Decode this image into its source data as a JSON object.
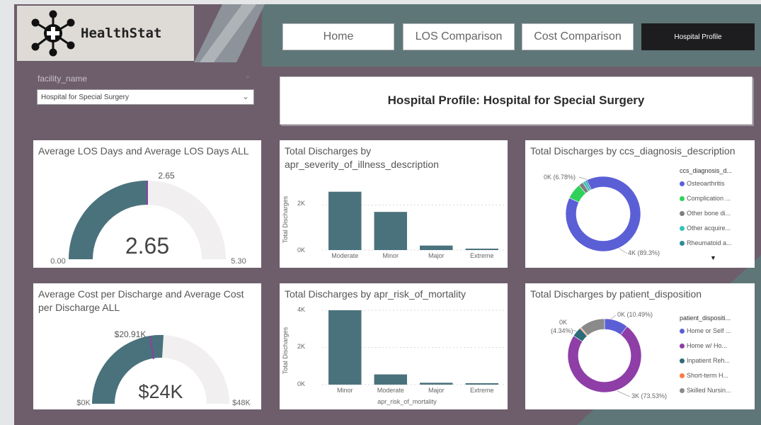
{
  "app": {
    "name": "HealthStat"
  },
  "nav": {
    "home": "Home",
    "los_comparison": "LOS Comparison",
    "cost_comparison": "Cost Comparison",
    "hospital_profile": "Hospital Profile"
  },
  "filter": {
    "label": "facility_name",
    "selected": "Hospital for Special Surgery"
  },
  "page_title": "Hospital Profile: Hospital for Special Surgery",
  "colors": {
    "teal": "#4a727c",
    "gauge_bg": "#f1efef",
    "purple_bg": "#6e5e6c",
    "blue": "#5b5fd6",
    "purple": "#8e3ea6",
    "green": "#2fd15a"
  },
  "cards": {
    "los_gauge": {
      "title": "Average LOS Days and Average LOS Days ALL",
      "value": "2.65",
      "target": "2.65",
      "min": "0.00",
      "max": "5.30"
    },
    "cost_gauge": {
      "title": "Average Cost per Discharge and Average Cost per Discharge ALL",
      "value": "$24K",
      "target": "$20.91K",
      "min": "$0K",
      "max": "$48K"
    },
    "severity": {
      "title": "Total Discharges by apr_severity_of_illness_description",
      "ylabel": "Total Discharges",
      "yticks": [
        "2K",
        "0K"
      ]
    },
    "mortality": {
      "title": "Total Discharges by apr_risk_of_mortality",
      "ylabel": "Total Discharges",
      "xlabel": "apr_risk_of_mortality",
      "yticks": [
        "4K",
        "2K",
        "0K"
      ]
    },
    "diagnosis": {
      "title": "Total Discharges by ccs_diagnosis_description",
      "legend_title": "ccs_diagnosis_d...",
      "legend": [
        "Osteoarthritis",
        "Complication ...",
        "Other bone di...",
        "Other acquire...",
        "Rheumatoid a..."
      ],
      "legend_colors": [
        "#5b5fd6",
        "#2fd15a",
        "#7f7f7f",
        "#33c4b6",
        "#2f8a99"
      ],
      "labels": [
        "0K (6.78%)",
        "4K (89.3%)"
      ]
    },
    "disposition": {
      "title": "Total Discharges by patient_disposition",
      "legend_title": "patient_dispositi...",
      "legend": [
        "Home or Self ...",
        "Home w/ Ho...",
        "Inpatient Reh...",
        "Short-term H...",
        "Skilled Nursin..."
      ],
      "legend_colors": [
        "#5b5fd6",
        "#8e3ea6",
        "#2e6b78",
        "#ff7a45",
        "#8a8a8a"
      ],
      "labels": [
        "0K (10.49%)",
        "0K",
        "(4.34%)",
        "3K (73.53%)"
      ]
    }
  },
  "chart_data": [
    {
      "type": "bar",
      "title": "Total Discharges by apr_severity_of_illness_description",
      "ylabel": "Total Discharges",
      "categories": [
        "Moderate",
        "Minor",
        "Major",
        "Extreme"
      ],
      "values": [
        2600,
        1700,
        200,
        30
      ],
      "ylim": [
        0,
        3000
      ]
    },
    {
      "type": "bar",
      "title": "Total Discharges by apr_risk_of_mortality",
      "xlabel": "apr_risk_of_mortality",
      "ylabel": "Total Discharges",
      "categories": [
        "Minor",
        "Moderate",
        "Major",
        "Extreme"
      ],
      "values": [
        4000,
        550,
        100,
        20
      ],
      "ylim": [
        0,
        4000
      ]
    },
    {
      "type": "pie",
      "title": "Total Discharges by ccs_diagnosis_description",
      "categories": [
        "Osteoarthritis",
        "Complication ...",
        "Other bone di...",
        "Other acquire...",
        "Rheumatoid a..."
      ],
      "values": [
        89.3,
        6.78,
        2.0,
        1.2,
        0.72
      ]
    },
    {
      "type": "pie",
      "title": "Total Discharges by patient_disposition",
      "categories": [
        "Home or Self ...",
        "Home w/ Ho...",
        "Inpatient Reh...",
        "Short-term H...",
        "Skilled Nursin..."
      ],
      "values": [
        10.49,
        73.53,
        4.34,
        0.5,
        11.14
      ]
    }
  ]
}
